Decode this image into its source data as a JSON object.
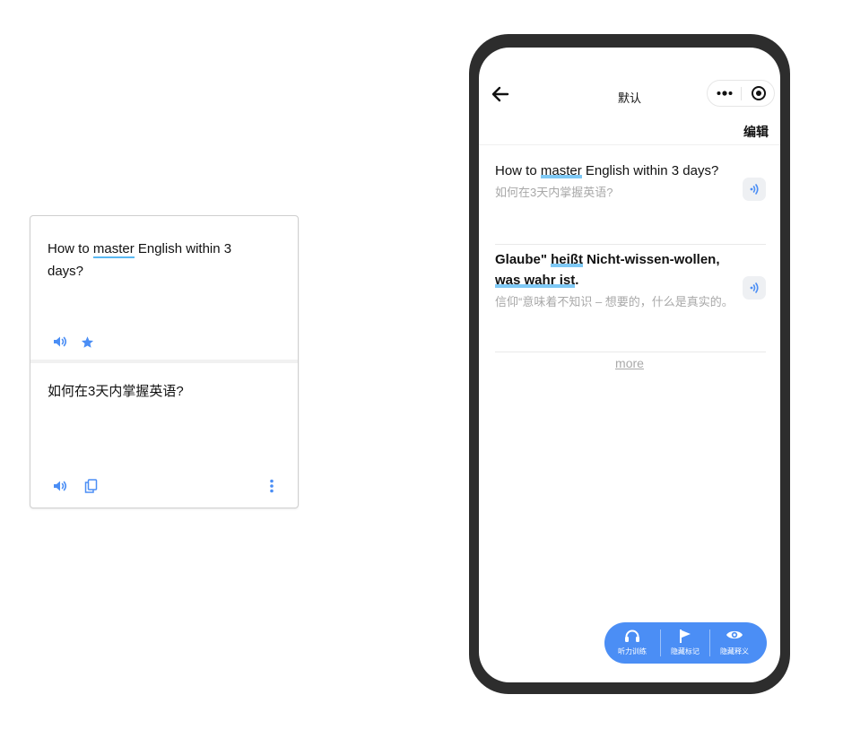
{
  "translator_card": {
    "source_text_prefix": "How to ",
    "source_highlight": "master",
    "source_text_suffix": " English within 3 days?",
    "target_text": "如何在3天内掌握英语?",
    "icons": [
      "speaker-icon",
      "star-icon",
      "speaker-icon",
      "copy-icon",
      "more-vertical-icon"
    ]
  },
  "phone": {
    "nav": {
      "title": "默认",
      "back_icon": "arrow-left-icon",
      "capsule_icons": [
        "more-dots-icon",
        "target-close-icon"
      ]
    },
    "edit_label": "编辑",
    "entries": [
      {
        "en_prefix": "How to ",
        "en_highlight": "master",
        "en_suffix": " English within 3 days?",
        "zh": "如何在3天内掌握英语?"
      },
      {
        "en_prefix": "Glaube\" ",
        "en_highlight": "heißt",
        "en_middle": " Nicht-wissen-wollen, ",
        "en_highlight2": "was wahr ist",
        "en_suffix": ".",
        "zh": "信仰“意味着不知识 – 想要的，什么是真实的。"
      }
    ],
    "more_label": "more",
    "toolbar": {
      "items": [
        {
          "label": "听力训练",
          "icon": "headphones-icon"
        },
        {
          "label": "隐藏标记",
          "icon": "flag-icon"
        },
        {
          "label": "隐藏释义",
          "icon": "eye-icon"
        }
      ]
    }
  },
  "colors": {
    "accent": "#4b8ef5",
    "highlight": "#7ec9f6",
    "phone_frame": "#2d2d2d",
    "muted_text": "#a8a8a8"
  }
}
